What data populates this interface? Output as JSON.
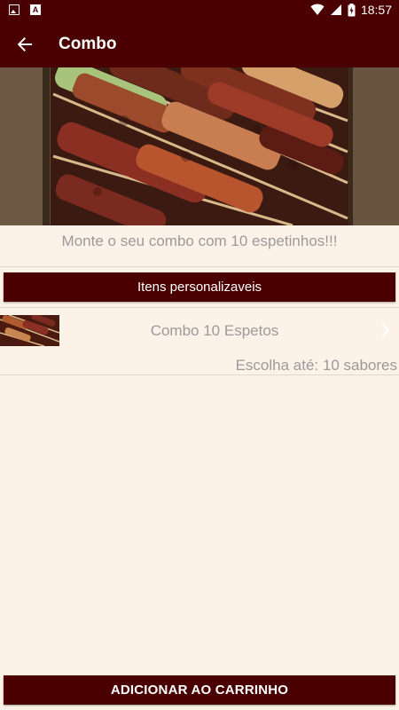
{
  "status_bar": {
    "time": "18:57",
    "left_icons": [
      "image-icon",
      "a-icon"
    ],
    "right_icons": [
      "wifi-icon",
      "signal-icon",
      "battery-icon"
    ]
  },
  "app_bar": {
    "title": "Combo",
    "back_icon": "arrow-left-icon",
    "color": "#4a0000"
  },
  "hero": {
    "image": "skewers-photo"
  },
  "main": {
    "subtitle": "Monte o seu combo com 10 espetinhos!!!",
    "custom_items_button": "Itens personalizaveis",
    "product": {
      "name": "Combo 10 Espetos",
      "choose_text": "Escolha até: 10 sabores",
      "chevron_icon": "chevron-right-icon"
    },
    "add_to_cart_button": "ADICIONAR AO CARRINHO"
  },
  "colors": {
    "accent": "#4a0000",
    "background": "#fdf2e7",
    "muted_text": "#9a9a9a"
  }
}
